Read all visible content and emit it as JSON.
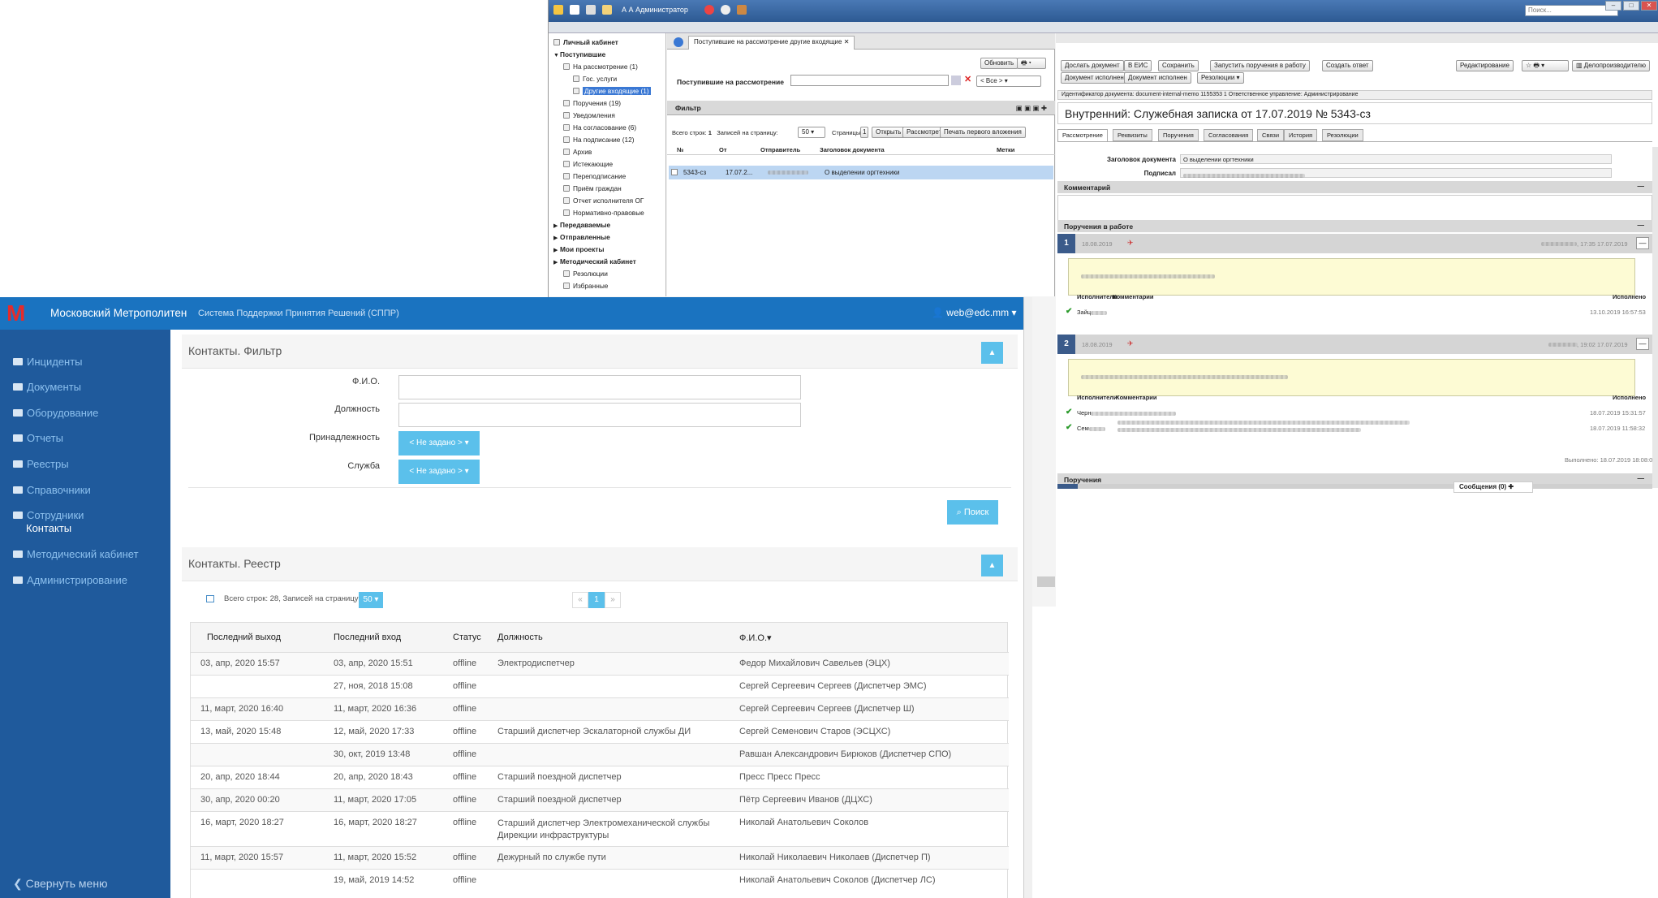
{
  "top": {
    "titlebar": {
      "user": "А А Администратор",
      "search_placeholder": "Поиск...",
      "min": "–",
      "max": "□",
      "close": "✕"
    },
    "tree": [
      {
        "t": "Личный кабинет",
        "b": true,
        "lvl": 0,
        "icon": true
      },
      {
        "t": "Поступившие",
        "b": true,
        "lvl": 0,
        "tri": "▼"
      },
      {
        "t": "На рассмотрение (1)",
        "lvl": 1,
        "icon": true
      },
      {
        "t": "Гос. услуги",
        "lvl": 2,
        "icon": true
      },
      {
        "t": "Другие входящие (1)",
        "lvl": 2,
        "icon": true,
        "sel": true
      },
      {
        "t": "Поручения (19)",
        "lvl": 1,
        "icon": true
      },
      {
        "t": "Уведомления",
        "lvl": 1,
        "icon": true
      },
      {
        "t": "На согласование (6)",
        "lvl": 1,
        "icon": true
      },
      {
        "t": "На подписание (12)",
        "lvl": 1,
        "icon": true
      },
      {
        "t": "Архив",
        "lvl": 1,
        "icon": true
      },
      {
        "t": "Истекающие",
        "lvl": 1,
        "icon": true
      },
      {
        "t": "Переподписание",
        "lvl": 1,
        "icon": true
      },
      {
        "t": "Приём граждан",
        "lvl": 1,
        "icon": true
      },
      {
        "t": "Отчет исполнителя ОГ",
        "lvl": 1,
        "icon": true
      },
      {
        "t": "Нормативно-правовые",
        "lvl": 1,
        "icon": true
      },
      {
        "t": "Передаваемые",
        "b": true,
        "lvl": 0,
        "tri": "▶"
      },
      {
        "t": "Отправленные",
        "b": true,
        "lvl": 0,
        "tri": "▶"
      },
      {
        "t": "Мои проекты",
        "b": true,
        "lvl": 0,
        "tri": "▶"
      },
      {
        "t": "Методический кабинет",
        "b": true,
        "lvl": 0,
        "tri": "▶"
      },
      {
        "t": "Резолюции",
        "lvl": 1,
        "icon": true
      },
      {
        "t": "Избранные",
        "lvl": 1,
        "icon": true
      }
    ],
    "mid": {
      "tab": "Поступившие на рассмотрение другие входящие",
      "tab_close": "✕",
      "refresh": "Обновить",
      "label": "Поступившие на рассмотрение",
      "all_select": "< Все >",
      "filter": "Фильтр",
      "total": "Всего строк:",
      "total_val": "1",
      "per_page": "Записей на страницу:",
      "per_page_val": "50",
      "pages": "Страницы:",
      "page_val": "1",
      "open": "Открыть",
      "review": "Рассмотреть",
      "print_first": "Печать первого вложения",
      "cols": [
        "№",
        "От",
        "Отправитель",
        "Заголовок документа",
        "Метки"
      ],
      "row": {
        "num": "5343-сз",
        "date": "17.07.2...",
        "title": "О выделении оргтехники"
      }
    },
    "right": {
      "toolbar1": [
        "Дослать документ",
        "В ЕИС",
        "Сохранить",
        "Запустить поручения в работу",
        "Создать ответ"
      ],
      "toolbar_right": [
        "Редактирование",
        "Делопроизводителю"
      ],
      "toolbar2": [
        "Документ исполнен",
        "Документ исполнен",
        "Резолюции"
      ],
      "ident": "Идентификатор документа: document-internal-memo 1155353 1 Ответственное управление: Администрирование",
      "doc_title": "Внутренний: Служебная записка  от  17.07.2019  №  5343-сз",
      "tabs": [
        "Рассмотрение",
        "Реквизиты",
        "Поручения",
        "Согласования",
        "Связи",
        "История",
        "Резолюции"
      ],
      "heading_lbl": "Заголовок документа",
      "heading_val": "О выделении оргтехники",
      "signed_lbl": "Подписал",
      "comment": "Комментарий",
      "orders_in_work": "Поручения в работе",
      "orders": [
        {
          "n": "1",
          "date": "18.08.2019",
          "time": ", 17:35 17.07.2019",
          "col_exec": "Исполнители",
          "col_comm": "Комментарии",
          "col_done": "Исполнено",
          "people": [
            {
              "name": "Зайц",
              "ts": "13.10.2019 16:57:53"
            }
          ]
        },
        {
          "n": "2",
          "date": "18.08.2019",
          "time": ", 19:02 17.07.2019",
          "col_exec": "Исполнители",
          "col_comm": "Комментарии",
          "col_done": "Исполнено",
          "people": [
            {
              "name": "Черн",
              "ts": "18.07.2019 15:31:57"
            },
            {
              "name": "Сем",
              "ts": "18.07.2019 11:58:32"
            }
          ],
          "done": "Выполнено: 18.07.2019 18:08:09"
        }
      ],
      "orders_footer": "Поручения",
      "messages": "Сообщения (0)"
    }
  },
  "app": {
    "brand": "Московский Метрополитен",
    "subtitle": "Система Поддержки Принятия Решений (СППР)",
    "user": "web@edc.mm",
    "menu": [
      "Инциденты",
      "Документы",
      "Оборудование",
      "Отчеты",
      "Реестры",
      "Справочники",
      "Сотрудники",
      "Методический кабинет",
      "Администрирование"
    ],
    "submenu": "Контакты",
    "collapse": "Свернуть меню",
    "filter_title": "Контакты. Фильтр",
    "fields": {
      "fio": "Ф.И.О.",
      "position": "Должность",
      "belongs": "Принадлежность",
      "service": "Служба",
      "not_set": "< Не задано >"
    },
    "search": "Поиск",
    "registry_title": "Контакты. Реестр",
    "total": "Всего строк: 28, Записей на страницу:",
    "per_page": "50",
    "page": "1",
    "prev": "«",
    "next": "»",
    "columns": [
      "Последний выход",
      "Последний вход",
      "Статус",
      "Должность",
      "Ф.И.О."
    ],
    "rows": [
      [
        "03, апр, 2020 15:57",
        "03, апр, 2020 15:51",
        "offline",
        "Электродиспетчер",
        "Федор Михайлович Савельев (ЭЦХ)"
      ],
      [
        "",
        "27, ноя, 2018 15:08",
        "offline",
        "",
        "Сергей Сергеевич Сергеев (Диспетчер ЭМС)"
      ],
      [
        "11, март, 2020 16:40",
        "11, март, 2020 16:36",
        "offline",
        "",
        "Сергей Сергеевич Сергеев (Диспетчер Ш)"
      ],
      [
        "13, май, 2020 15:48",
        "12, май, 2020 17:33",
        "offline",
        "Старший диспетчер Эскалаторной службы ДИ",
        "Сергей Семенович Старов (ЭСЦХС)"
      ],
      [
        "",
        "30, окт, 2019 13:48",
        "offline",
        "",
        "Равшан Александрович Бирюков (Диспетчер СПО)"
      ],
      [
        "20, апр, 2020 18:44",
        "20, апр, 2020 18:43",
        "offline",
        "Старший поездной диспетчер",
        "Пресс Пресс Пресс"
      ],
      [
        "30, апр, 2020 00:20",
        "11, март, 2020 17:05",
        "offline",
        "Старший поездной диспетчер",
        "Пётр Сергеевич Иванов (ДЦХС)"
      ],
      [
        "16, март, 2020 18:27",
        "16, март, 2020 18:27",
        "offline",
        "Старший диспетчер Электромеханической службы|Дирекции инфраструктуры",
        "Николай Анатольевич Соколов"
      ],
      [
        "11, март, 2020 15:57",
        "11, март, 2020 15:52",
        "offline",
        "Дежурный по службе пути",
        "Николай Николаевич Николаев (Диспетчер П)"
      ],
      [
        "",
        "19, май, 2019 14:52",
        "offline",
        "",
        "Николай Анатольевич Соколов (Диспетчер ЛС)"
      ]
    ]
  }
}
